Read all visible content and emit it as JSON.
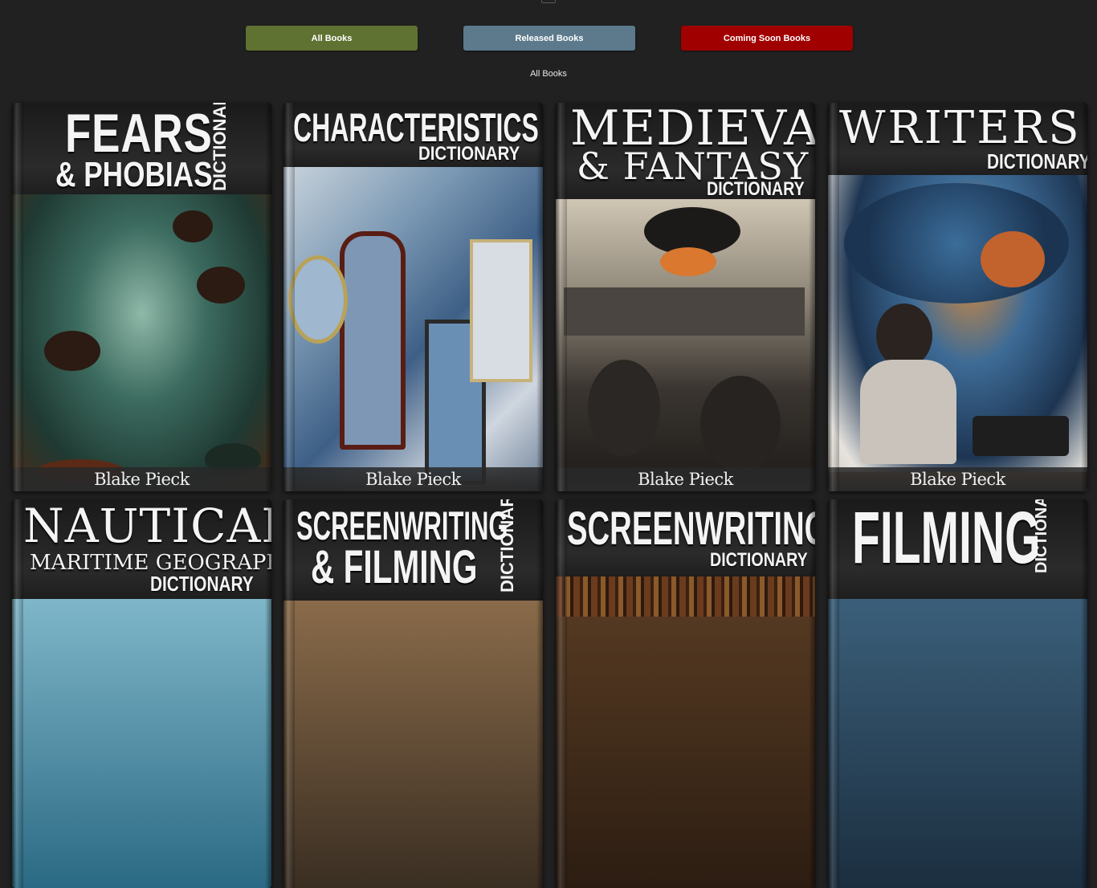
{
  "filters": {
    "all_label": "All Books",
    "released_label": "Released Books",
    "coming_soon_label": "Coming Soon Books",
    "all_color": "#5f7232",
    "released_color": "#5c7a8c",
    "coming_soon_color": "#a00000"
  },
  "section": {
    "heading": "All Books"
  },
  "books": [
    {
      "title_line1": "FEARS",
      "title_line2": "& PHOBIAS",
      "subtitle": "DICTIONARY",
      "author": "Blake Pieck"
    },
    {
      "title_line1": "CHARACTERISTICS",
      "subtitle": "DICTIONARY",
      "author": "Blake Pieck"
    },
    {
      "title_line1": "MEDIEVAL",
      "title_line2": "& FANTASY",
      "subtitle": "DICTIONARY",
      "author": "Blake Pieck"
    },
    {
      "title_line1": "WRITERS",
      "subtitle": "DICTIONARY",
      "author": "Blake Pieck"
    },
    {
      "title_line1": "NAUTICAL",
      "title_line2": "MARITIME GEOGRAPHY",
      "subtitle": "DICTIONARY"
    },
    {
      "title_line1": "SCREENWRITING",
      "title_line2": "& FILMING",
      "subtitle": "DICTIONARY"
    },
    {
      "title_line1": "SCREENWRITING",
      "subtitle": "DICTIONARY"
    },
    {
      "title_line1": "FILMING",
      "subtitle": "DICTIONARY"
    }
  ]
}
